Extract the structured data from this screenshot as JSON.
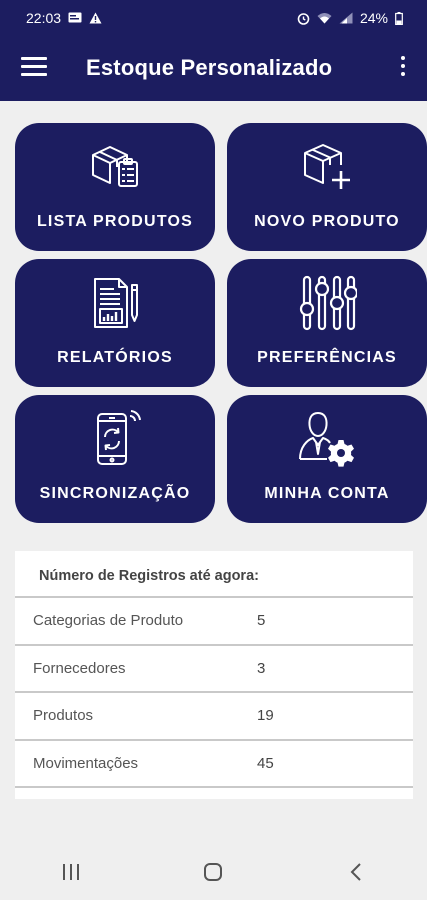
{
  "status_bar": {
    "time": "22:03",
    "battery": "24%"
  },
  "app_bar": {
    "title": "Estoque Personalizado",
    "menu_icon": "hamburger-menu-icon",
    "more_icon": "more-vertical-icon"
  },
  "tiles": [
    {
      "label": "LISTA PRODUTOS",
      "icon": "box-list-icon"
    },
    {
      "label": "NOVO PRODUTO",
      "icon": "box-add-icon"
    },
    {
      "label": "RELATÓRIOS",
      "icon": "report-icon"
    },
    {
      "label": "PREFERÊNCIAS",
      "icon": "sliders-icon"
    },
    {
      "label": "SINCRONIZAÇÃO",
      "icon": "phone-sync-icon"
    },
    {
      "label": "MINHA CONTA",
      "icon": "user-gear-icon"
    }
  ],
  "summary": {
    "header": "Número de Registros até agora:",
    "rows": [
      {
        "label": "Categorias de Produto",
        "value": "5"
      },
      {
        "label": "Fornecedores",
        "value": "3"
      },
      {
        "label": "Produtos",
        "value": "19"
      },
      {
        "label": "Movimentações",
        "value": "45"
      }
    ]
  },
  "colors": {
    "primary": "#1c1d60",
    "background": "#efefef",
    "card": "#ffffff"
  }
}
